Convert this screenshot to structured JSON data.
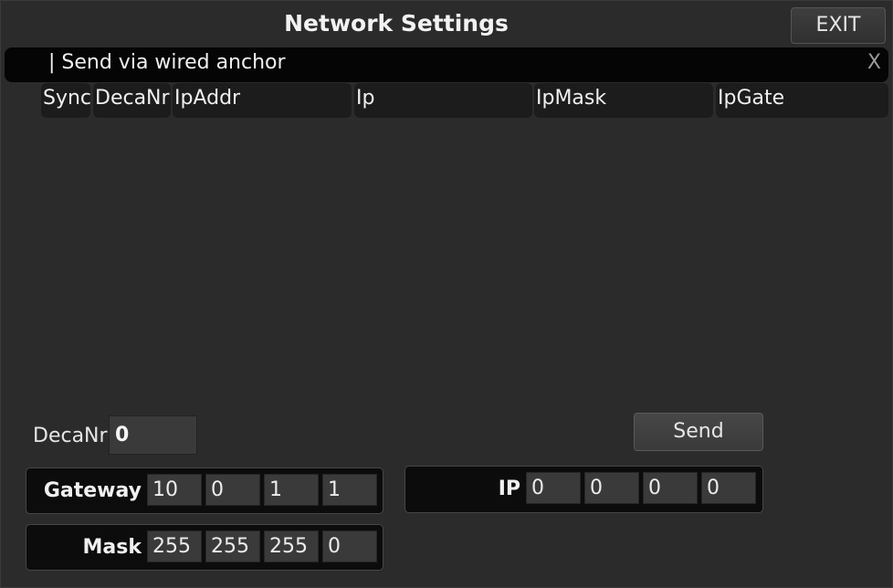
{
  "window": {
    "title": "Network Settings",
    "exit_label": "EXIT"
  },
  "tab": {
    "label": "| Send via wired anchor",
    "close_label": "X"
  },
  "table": {
    "columns": [
      "Sync",
      "DecaNr",
      "IpAddr",
      "Ip",
      "IpMask",
      "IpGate"
    ],
    "rows": []
  },
  "form": {
    "decanr_label": "DecaNr",
    "decanr_value": "0",
    "send_label": "Send",
    "gateway": {
      "label": "Gateway",
      "octets": [
        "10",
        "0",
        "1",
        "1"
      ]
    },
    "mask": {
      "label": "Mask",
      "octets": [
        "255",
        "255",
        "255",
        "0"
      ]
    },
    "ip": {
      "label": "IP",
      "octets": [
        "0",
        "0",
        "0",
        "0"
      ]
    }
  }
}
